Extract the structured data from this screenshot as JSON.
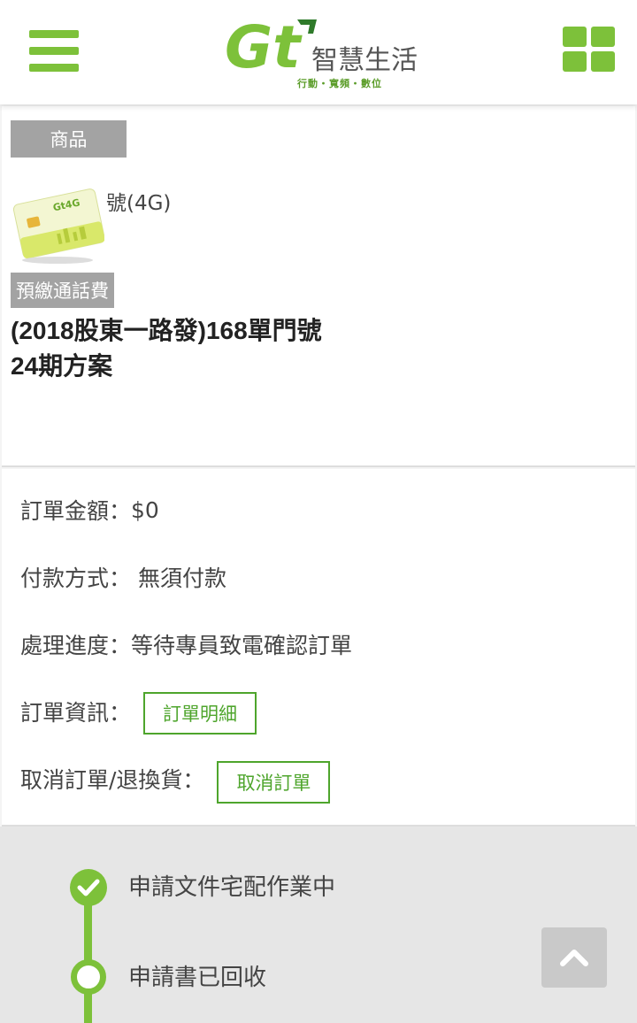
{
  "header": {
    "logo_mark": "Gt",
    "logo_text": "智慧生活",
    "tagline": "行動・寬頻・數位"
  },
  "product": {
    "tag": "商品",
    "title_short": "號(4G)",
    "sim_label": "Gt4G",
    "category_tag": "預繳通話費",
    "plan_line1": "(2018股東一路發)168單門號",
    "plan_line2": "24期方案"
  },
  "order": {
    "amount_label": "訂單金額：",
    "amount_value": "$0",
    "payment_label": "付款方式：",
    "payment_value": "無須付款",
    "progress_label": "處理進度：",
    "progress_value": "等待專員致電確認訂單",
    "info_label": "訂單資訊：",
    "detail_button": "訂單明細",
    "cancel_label": "取消訂單/退換貨：",
    "cancel_button": "取消訂單"
  },
  "timeline": {
    "steps": [
      {
        "label": "申請文件宅配作業中",
        "status": "done"
      },
      {
        "label": "申請書已回收",
        "status": "pending"
      }
    ]
  },
  "colors": {
    "accent": "#7dc13a",
    "button_green": "#4ea52c",
    "tag_gray": "#a3a3a3"
  }
}
